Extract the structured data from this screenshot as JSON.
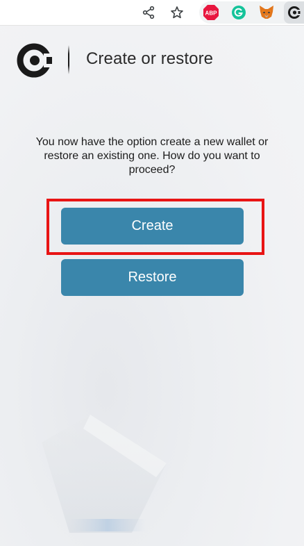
{
  "toolbar": {
    "icons": [
      "share-icon",
      "star-icon"
    ],
    "extensions": [
      {
        "name": "adblock-plus-icon",
        "label": "ABP",
        "color": "#e8173f"
      },
      {
        "name": "grammarly-icon",
        "label": "G",
        "color": "#15c39a"
      },
      {
        "name": "metamask-icon",
        "color": "#e2761b"
      },
      {
        "name": "wallet-extension-icon",
        "color": "#1a1a1a"
      }
    ]
  },
  "header": {
    "title": "Create or restore"
  },
  "main": {
    "prompt": "You now have the option create a new wallet or restore an existing one. How do you want to proceed?",
    "create_label": "Create",
    "restore_label": "Restore"
  },
  "colors": {
    "button": "#3a86ab",
    "highlight": "#e81414",
    "text": "#1c1c1c"
  }
}
